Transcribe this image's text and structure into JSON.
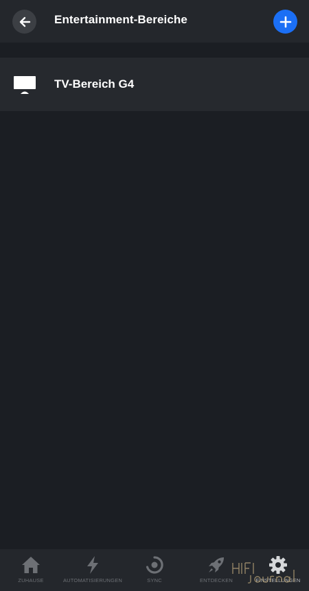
{
  "header": {
    "title": "Entertainment-Bereiche",
    "back_icon": "arrow-left-icon",
    "add_icon": "plus-icon"
  },
  "areas": [
    {
      "name": "TV-Bereich G4",
      "icon": "tv-icon"
    }
  ],
  "bottom_nav": {
    "items": [
      {
        "label": "ZUHAUSE",
        "icon": "home-icon",
        "active": false
      },
      {
        "label": "AUTOMATISIERUNGEN",
        "icon": "lightning-icon",
        "active": false
      },
      {
        "label": "SYNC",
        "icon": "sync-icon",
        "active": false
      },
      {
        "label": "ENTDECKEN",
        "icon": "rocket-icon",
        "active": false
      },
      {
        "label": "EINSTELLUNGEN",
        "icon": "gear-icon",
        "active": true
      }
    ]
  },
  "watermark": {
    "text": "HIFI Journal"
  },
  "colors": {
    "background": "#1b1e23",
    "header": "#24272c",
    "list_item": "#26292e",
    "accent": "#1b6ff5",
    "inactive_nav": "#6d7075"
  }
}
